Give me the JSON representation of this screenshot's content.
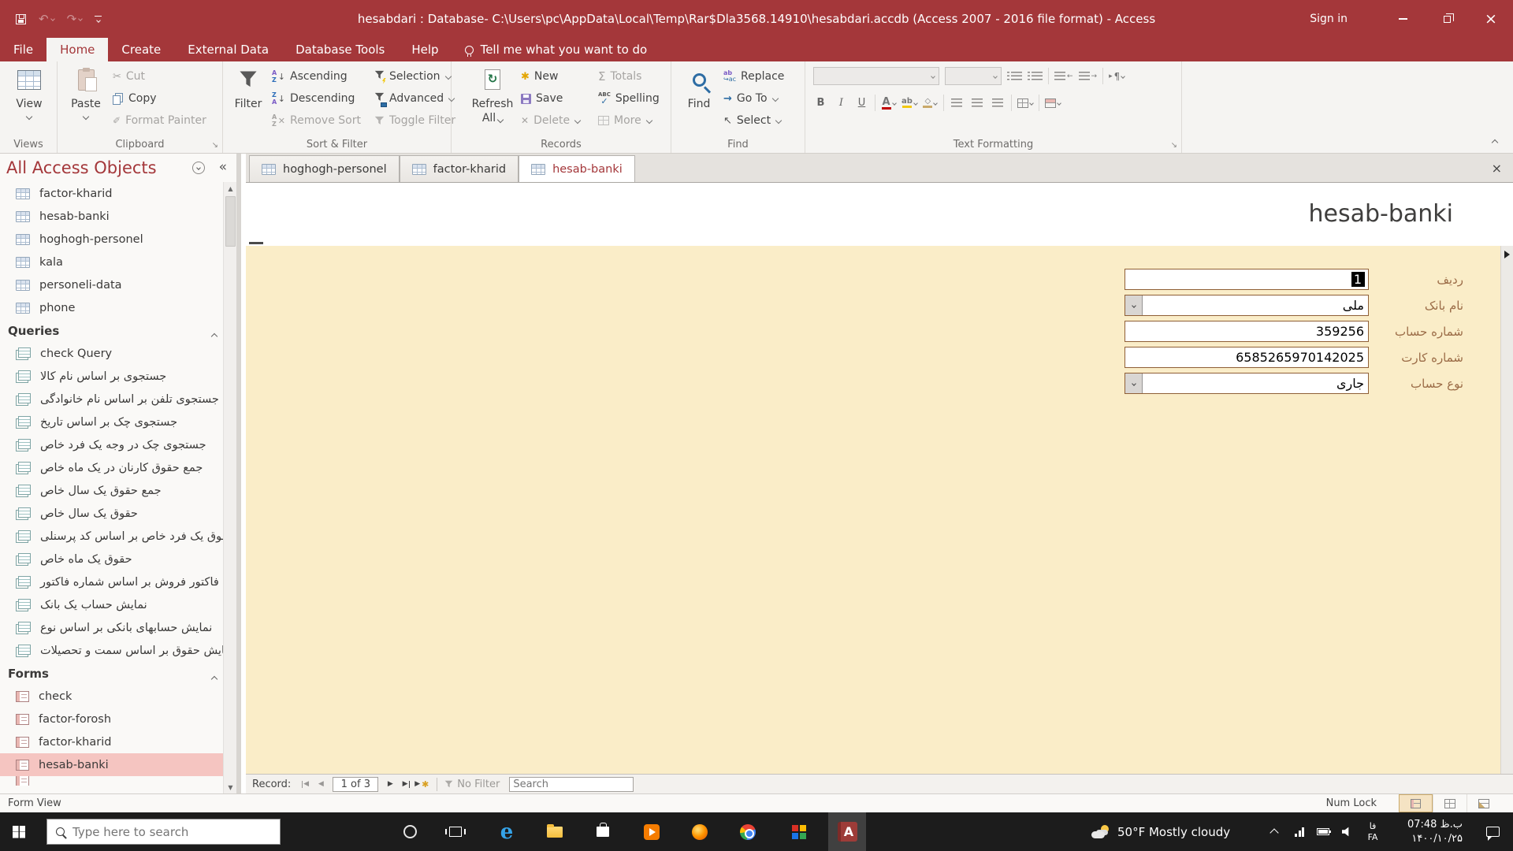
{
  "colors": {
    "accent": "#A4373A",
    "form_bg": "#FAEDC8",
    "field_border": "#8F5F36",
    "field_label": "#9B6C47",
    "nav_selected": "#F5C5C1"
  },
  "titlebar": {
    "title": "hesabdari : Database- C:\\Users\\pc\\AppData\\Local\\Temp\\Rar$Dla3568.14910\\hesabdari.accdb (Access 2007 - 2016 file format)  -  Access",
    "sign_in": "Sign in"
  },
  "ribbon_tabs": {
    "file": "File",
    "tabs": [
      {
        "label": "Home",
        "active": true
      },
      {
        "label": "Create"
      },
      {
        "label": "External Data"
      },
      {
        "label": "Database Tools"
      },
      {
        "label": "Help"
      }
    ],
    "tell_me": "Tell me what you want to do"
  },
  "ribbon": {
    "views": {
      "label": "Views",
      "view": "View"
    },
    "clipboard": {
      "label": "Clipboard",
      "paste": "Paste",
      "cut": "Cut",
      "copy": "Copy",
      "format_painter": "Format Painter"
    },
    "sort_filter": {
      "label": "Sort & Filter",
      "filter": "Filter",
      "ascending": "Ascending",
      "descending": "Descending",
      "remove_sort": "Remove Sort",
      "selection": "Selection",
      "advanced": "Advanced",
      "toggle_filter": "Toggle Filter"
    },
    "records": {
      "label": "Records",
      "refresh_line1": "Refresh",
      "refresh_line2": "All",
      "new": "New",
      "save": "Save",
      "delete": "Delete",
      "totals": "Totals",
      "spelling": "Spelling",
      "more": "More"
    },
    "find": {
      "label": "Find",
      "find": "Find",
      "replace": "Replace",
      "go_to": "Go To",
      "select": "Select"
    },
    "text_formatting": {
      "label": "Text Formatting",
      "bold": "B",
      "italic": "I",
      "underline": "U",
      "font_color": "A",
      "highlight": "ab"
    }
  },
  "doc_tabs": [
    {
      "label": "hoghogh-personel"
    },
    {
      "label": "factor-kharid"
    },
    {
      "label": "hesab-banki",
      "active": true
    }
  ],
  "nav_pane": {
    "title": "All Access Objects",
    "tables": [
      {
        "label": "factor-kharid"
      },
      {
        "label": "hesab-banki"
      },
      {
        "label": "hoghogh-personel"
      },
      {
        "label": "kala"
      },
      {
        "label": "personeli-data"
      },
      {
        "label": "phone"
      }
    ],
    "queries_header": "Queries",
    "queries": [
      {
        "label": "check Query"
      },
      {
        "label": "جستجوی بر اساس نام کالا"
      },
      {
        "label": "جستجوی تلفن بر اساس نام خانوادگی"
      },
      {
        "label": "جستجوی چک بر اساس تاریخ"
      },
      {
        "label": "جستجوی چک در وجه یک فرد خاص"
      },
      {
        "label": "جمع حقوق کارنان در یک ماه خاص"
      },
      {
        "label": "جمع حقوق یک سال خاص"
      },
      {
        "label": "حقوق یک سال خاص"
      },
      {
        "label": "حقوق یک فرد خاص بر اساس کد پرسنلی"
      },
      {
        "label": "حقوق یک ماه خاص"
      },
      {
        "label": "فاکتور فروش بر اساس شماره فاکتور"
      },
      {
        "label": "نمایش حساب یک بانک"
      },
      {
        "label": "نمایش حسابهای بانکی بر اساس نوع"
      },
      {
        "label": "نمایش حقوق بر اساس سمت و تحصیلات"
      }
    ],
    "forms_header": "Forms",
    "forms": [
      {
        "label": "check"
      },
      {
        "label": "factor-forosh"
      },
      {
        "label": "factor-kharid"
      },
      {
        "label": "hesab-banki",
        "selected": true
      }
    ]
  },
  "form": {
    "title": "hesab-banki",
    "fields": [
      {
        "label": "ردیف",
        "value": "1",
        "selected": true
      },
      {
        "label": "نام بانک",
        "value": "ملی",
        "combo": true
      },
      {
        "label": "شماره حساب",
        "value": "359256"
      },
      {
        "label": "شماره کارت",
        "value": "6585265970142025"
      },
      {
        "label": "نوع حساب",
        "value": "جاری",
        "combo": true
      }
    ]
  },
  "record_nav": {
    "record_label": "Record:",
    "position": "1 of 3",
    "no_filter": "No Filter",
    "search_placeholder": "Search"
  },
  "status_bar": {
    "view_state": "Form View",
    "num_lock": "Num Lock"
  },
  "taskbar": {
    "search_placeholder": "Type here to search",
    "weather": "50°F  Mostly cloudy",
    "lang_top": "فا",
    "lang_bottom": "FA",
    "time": "07:48 ب.ظ",
    "date": "۱۴۰۰/۱۰/۲۵"
  }
}
